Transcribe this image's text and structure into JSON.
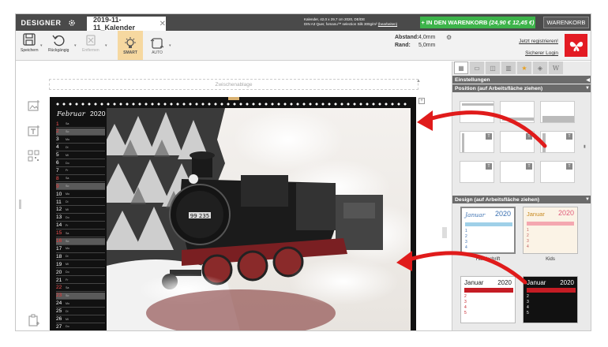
{
  "tabbar": {
    "designer_label": "DESIGNER",
    "doc_tab": "2019-11-11_Kalender",
    "product_info_line1": "Kalender, 42,0 x 29,7 cm 2020, DE/DE",
    "product_info_line2": "DIN A3 Quer, fomanu™ selection Silk 300g/m²",
    "product_info_edit": "(bearbeiten)",
    "cart_prefix": "+ IN DEN WARENKORB",
    "cart_price": "(24,90 € 12,45 €)",
    "warenkorb": "WARENKORB"
  },
  "toolbar": {
    "save": "Speichern",
    "undo": "Rückgängig",
    "remove": "Entfernen",
    "smart": "SMART",
    "auto": "AUTO",
    "abstand_label": "Abstand:",
    "abstand_value": "4,0mm",
    "rand_label": "Rand:",
    "rand_value": "5,0mm",
    "register": "Jetzt registrieren!",
    "login": "Sicherer Login"
  },
  "workspace": {
    "clipboard": "Zwischenablage"
  },
  "calendar": {
    "month": "Februar",
    "year": "2020",
    "days": [
      {
        "n": "1",
        "w": "Sa"
      },
      {
        "n": "2",
        "w": "So"
      },
      {
        "n": "3",
        "w": "Mo"
      },
      {
        "n": "4",
        "w": "Di"
      },
      {
        "n": "5",
        "w": "Mi"
      },
      {
        "n": "6",
        "w": "Do"
      },
      {
        "n": "7",
        "w": "Fr"
      },
      {
        "n": "8",
        "w": "Sa"
      },
      {
        "n": "9",
        "w": "So"
      },
      {
        "n": "10",
        "w": "Mo"
      },
      {
        "n": "11",
        "w": "Di"
      },
      {
        "n": "12",
        "w": "Mi"
      },
      {
        "n": "13",
        "w": "Do"
      },
      {
        "n": "14",
        "w": "Fr"
      },
      {
        "n": "15",
        "w": "Sa"
      },
      {
        "n": "16",
        "w": "So"
      },
      {
        "n": "17",
        "w": "Mo"
      },
      {
        "n": "18",
        "w": "Di"
      },
      {
        "n": "19",
        "w": "Mi"
      },
      {
        "n": "20",
        "w": "Do"
      },
      {
        "n": "21",
        "w": "Fr"
      },
      {
        "n": "22",
        "w": "Sa"
      },
      {
        "n": "23",
        "w": "So"
      },
      {
        "n": "24",
        "w": "Mo"
      },
      {
        "n": "25",
        "w": "Di"
      },
      {
        "n": "26",
        "w": "Mi"
      },
      {
        "n": "27",
        "w": "Do"
      }
    ],
    "loco_number": "99 235"
  },
  "panel": {
    "einstellungen": "Einstellungen",
    "position": "Position (auf Arbeitsfläche ziehen)",
    "design": "Design (auf Arbeitsfläche ziehen)",
    "design_1_name": "Handschrift",
    "design_2_name": "Kids",
    "design_1_title": "Januar",
    "design_1_year": "2020",
    "design_2_title": "Januar",
    "design_2_year": "2020",
    "design_3_title": "Januar",
    "design_3_year": "2020",
    "design_4_title": "Januar",
    "design_4_year": "2020",
    "tab_w": "W"
  },
  "colors": {
    "accent_green": "#3db44a",
    "brand_red": "#e31b23",
    "arrow_red": "#e01b1b"
  }
}
